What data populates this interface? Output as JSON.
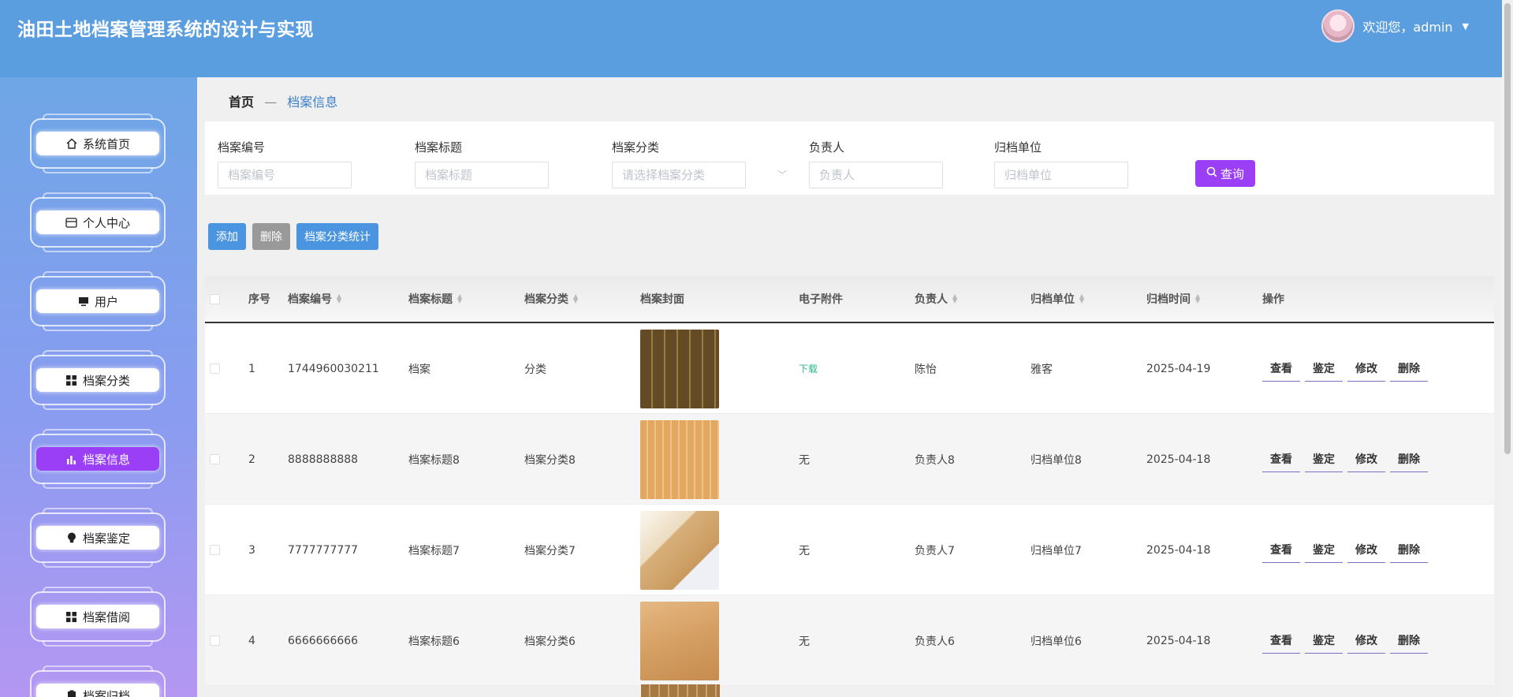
{
  "header": {
    "title": "油田土地档案管理系统的设计与实现",
    "welcome": "欢迎您，admin",
    "caret_icon": "caret-down-icon"
  },
  "sidebar": {
    "items": [
      {
        "label": "系统首页",
        "icon": "home-icon",
        "active": false
      },
      {
        "label": "个人中心",
        "icon": "id-card-icon",
        "active": false
      },
      {
        "label": "用户",
        "icon": "monitor-icon",
        "active": false
      },
      {
        "label": "档案分类",
        "icon": "grid-icon",
        "active": false
      },
      {
        "label": "档案信息",
        "icon": "bar-chart-icon",
        "active": true
      },
      {
        "label": "档案鉴定",
        "icon": "bulb-icon",
        "active": false
      },
      {
        "label": "档案借阅",
        "icon": "grid-icon",
        "active": false
      },
      {
        "label": "档案归档",
        "icon": "clipboard-icon",
        "active": false
      }
    ]
  },
  "breadcrumb": {
    "home": "首页",
    "separator": "—",
    "current": "档案信息"
  },
  "search": {
    "fields": [
      {
        "label": "档案编号",
        "placeholder": "档案编号"
      },
      {
        "label": "档案标题",
        "placeholder": "档案标题"
      },
      {
        "label": "档案分类",
        "placeholder": "请选择档案分类"
      },
      {
        "label": "负责人",
        "placeholder": "负责人"
      },
      {
        "label": "归档单位",
        "placeholder": "归档单位"
      }
    ],
    "query_label": "查询"
  },
  "actions": {
    "add": "添加",
    "delete": "删除",
    "stats": "档案分类统计"
  },
  "table": {
    "headers": [
      "序号",
      "档案编号",
      "档案标题",
      "档案分类",
      "档案封面",
      "电子附件",
      "负责人",
      "归档单位",
      "归档时间",
      "操作"
    ],
    "rows": [
      {
        "index": "1",
        "code": "1744960030211",
        "title": "档案",
        "category": "分类",
        "attachment": "下载",
        "owner": "陈怡",
        "unit": "雅客",
        "date": "2025-04-19"
      },
      {
        "index": "2",
        "code": "8888888888",
        "title": "档案标题8",
        "category": "档案分类8",
        "attachment": "无",
        "owner": "负责人8",
        "unit": "归档单位8",
        "date": "2025-04-18"
      },
      {
        "index": "3",
        "code": "7777777777",
        "title": "档案标题7",
        "category": "档案分类7",
        "attachment": "无",
        "owner": "负责人7",
        "unit": "归档单位7",
        "date": "2025-04-18"
      },
      {
        "index": "4",
        "code": "6666666666",
        "title": "档案标题6",
        "category": "档案分类6",
        "attachment": "无",
        "owner": "负责人6",
        "unit": "归档单位6",
        "date": "2025-04-18"
      }
    ],
    "ops": [
      "查看",
      "鉴定",
      "修改",
      "删除"
    ]
  },
  "colors": {
    "header": "#5b9ee0",
    "accent": "#9a3ff5",
    "primary_button": "#4b95e0",
    "download_link": "#2bb58a"
  }
}
